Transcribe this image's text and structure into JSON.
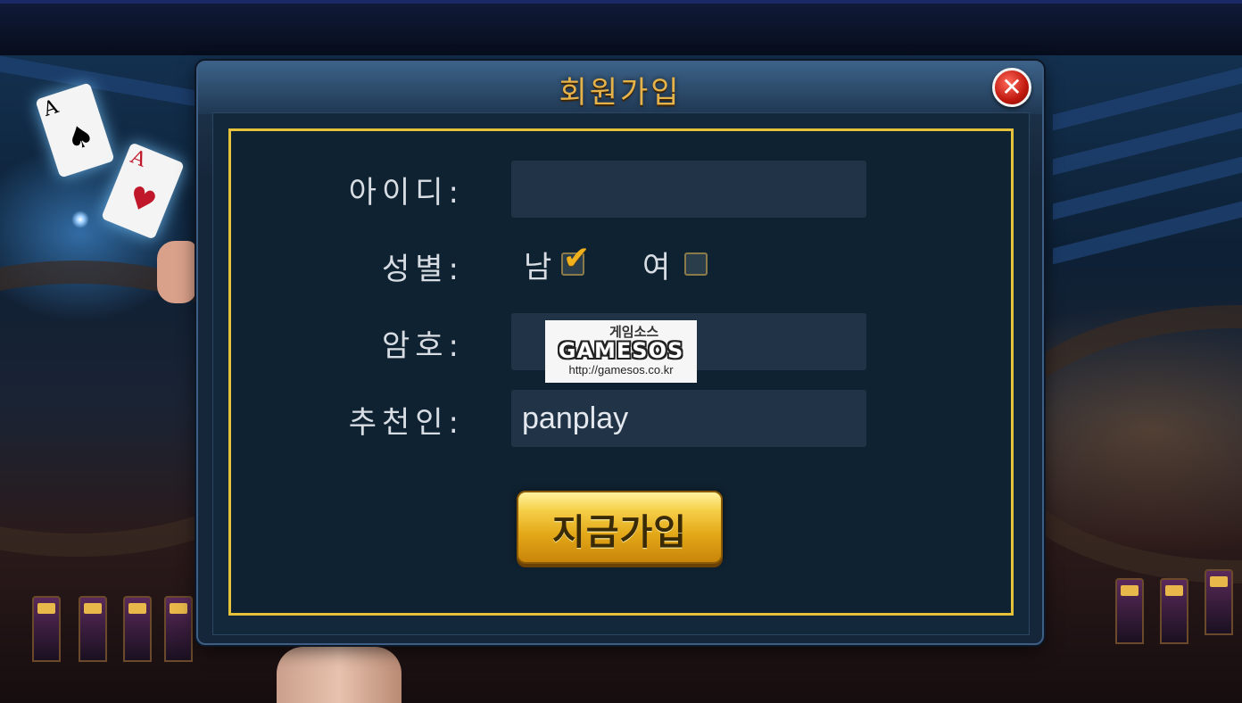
{
  "dialog": {
    "title": "회원가입",
    "close_glyph": "✕",
    "close_icon": "close-icon"
  },
  "form": {
    "id_label": "아이디:",
    "id_value": "",
    "gender_label": "성별:",
    "gender_male": "남",
    "gender_female": "여",
    "gender_male_checked": true,
    "gender_female_checked": false,
    "check_glyph": "✔",
    "password_label": "암호:",
    "password_value": "",
    "recommender_label": "추천인:",
    "recommender_value": "panplay",
    "submit_label": "지금가입"
  },
  "watermark": {
    "top_text": "게임소스",
    "logo_text": "GAMESOS",
    "url_text": "http://gamesos.co.kr"
  },
  "background_cards": {
    "card1_rank": "A",
    "card1_suit": "♠",
    "card2_rank": "A",
    "card2_suit": "♥"
  },
  "colors": {
    "title_gold": "#e6b24a",
    "frame_gold": "#e5c23a",
    "button_gold": "#f6d04a"
  }
}
